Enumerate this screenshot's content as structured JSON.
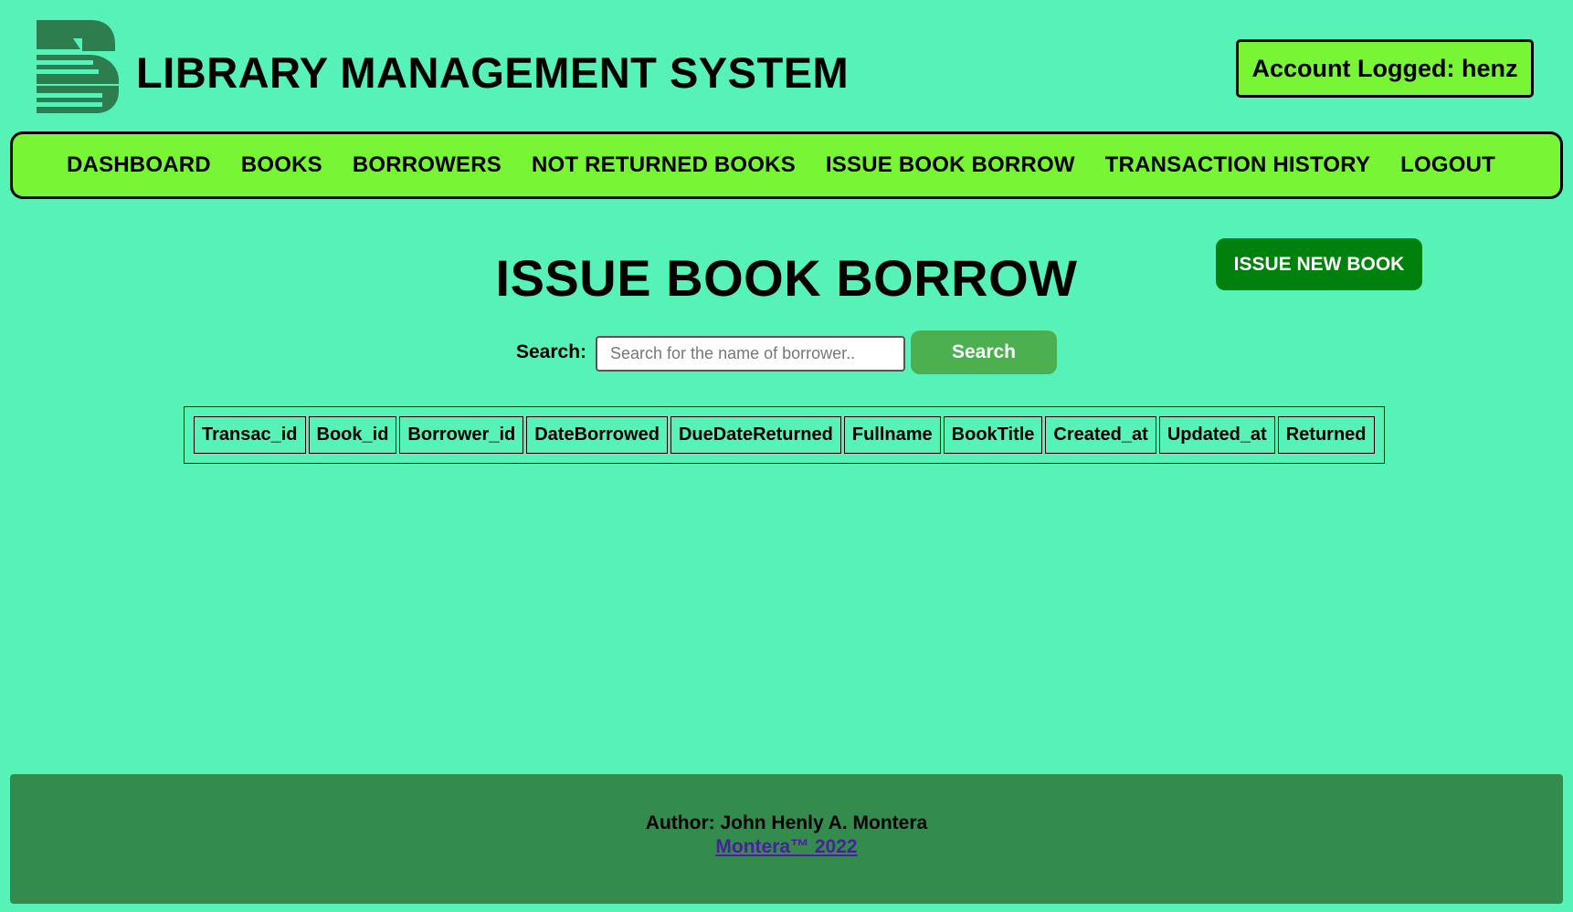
{
  "header": {
    "title": "LIBRARY MANAGEMENT SYSTEM",
    "account_label": "Account Logged: henz",
    "logo_icon": "books-logo-icon"
  },
  "nav": {
    "items": [
      {
        "label": "DASHBOARD"
      },
      {
        "label": "BOOKS"
      },
      {
        "label": "BORROWERS"
      },
      {
        "label": "NOT RETURNED BOOKS"
      },
      {
        "label": "ISSUE BOOK BORROW"
      },
      {
        "label": "TRANSACTION HISTORY"
      },
      {
        "label": "LOGOUT"
      }
    ]
  },
  "main": {
    "page_title": "ISSUE BOOK BORROW",
    "issue_new_label": "ISSUE NEW BOOK",
    "search_label": "Search:",
    "search_placeholder": "Search for the name of borrower..",
    "search_value": "",
    "search_button_label": "Search",
    "table": {
      "columns": [
        "Transac_id",
        "Book_id",
        "Borrower_id",
        "DateBorrowed",
        "DueDateReturned",
        "Fullname",
        "BookTitle",
        "Created_at",
        "Updated_at",
        "Returned"
      ],
      "rows": []
    }
  },
  "footer": {
    "author": "Author: John Henly A. Montera",
    "link_text": "Montera™ 2022"
  },
  "colors": {
    "background": "#57f2b8",
    "nav_bg": "#78f534",
    "issue_button": "#00800c",
    "search_button": "#4caf50",
    "footer_bg": "#338b4e",
    "link": "#4b1fa0"
  }
}
